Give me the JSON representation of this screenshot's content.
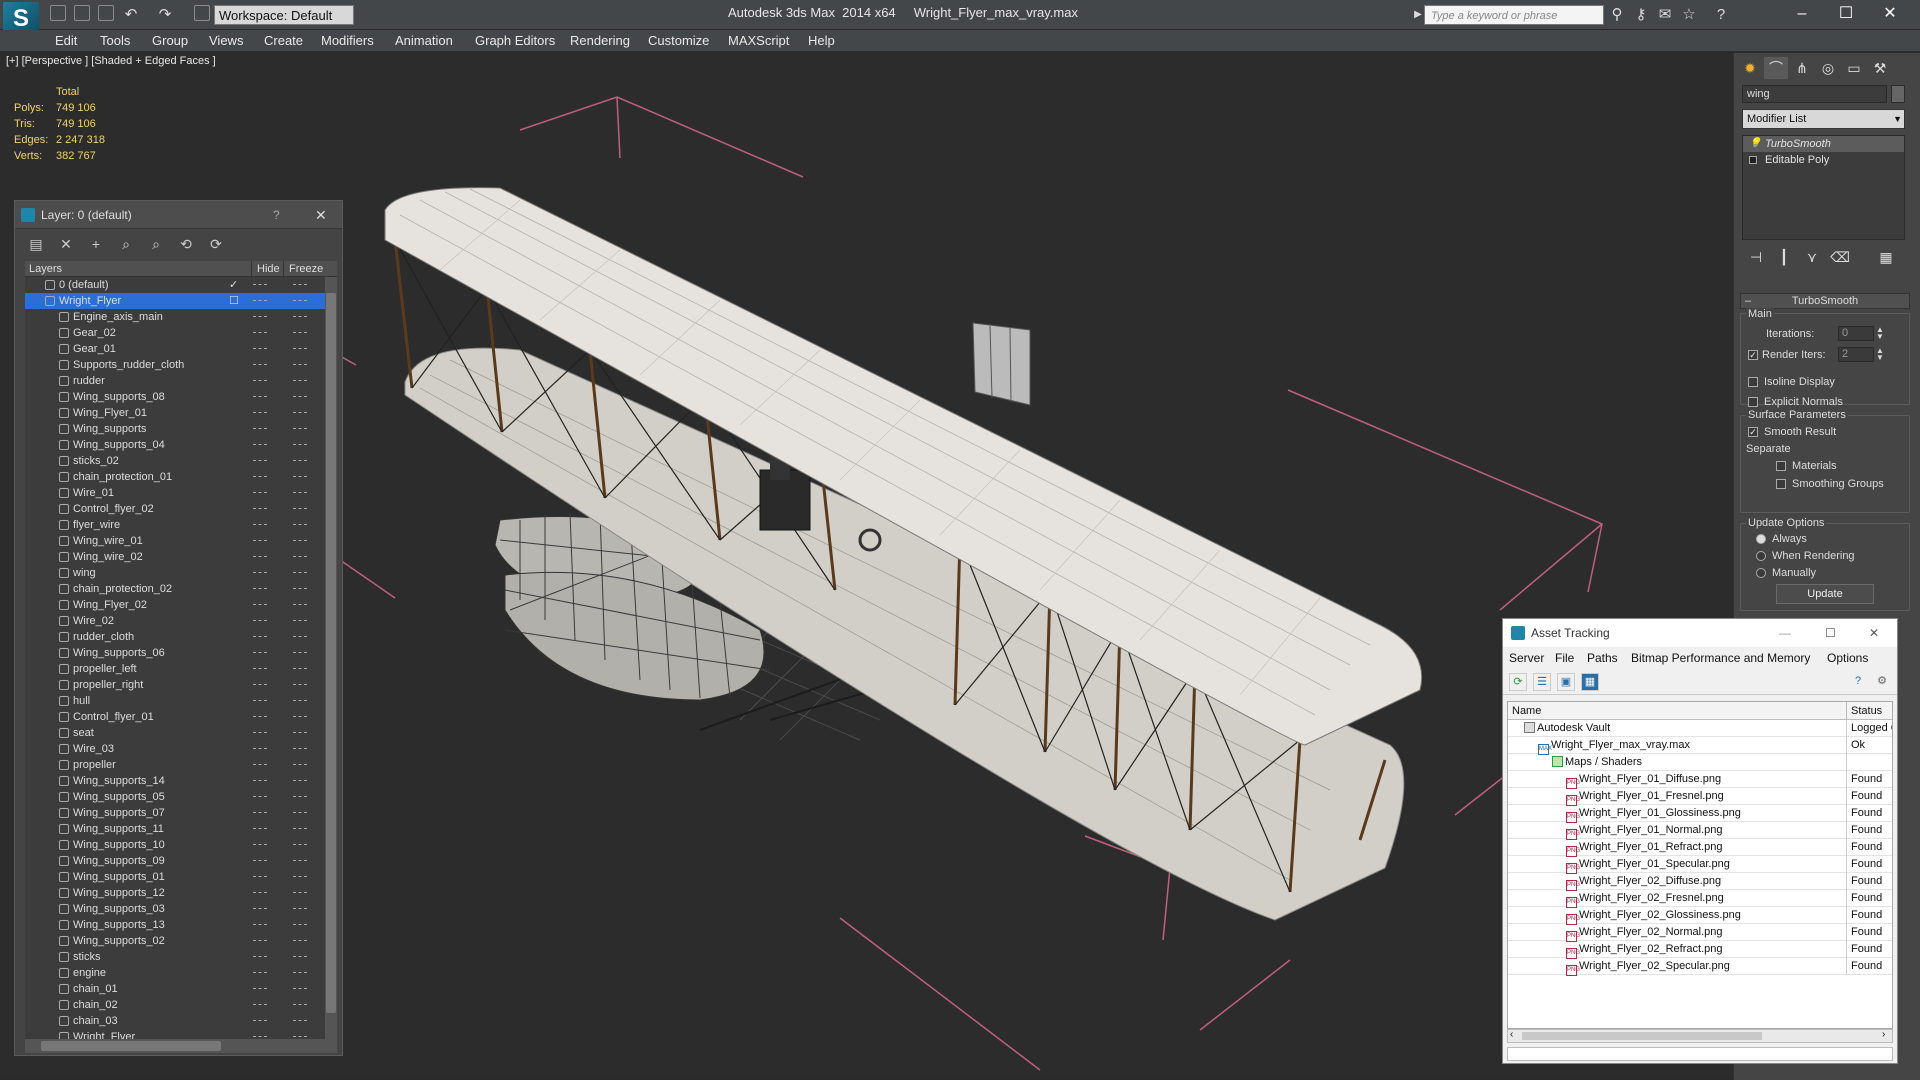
{
  "titlebar": {
    "workspace": "Workspace: Default",
    "app_name": "Autodesk 3ds Max  2014 x64",
    "file_name": "Wright_Flyer_max_vray.max",
    "search_placeholder": "Type a keyword or phrase"
  },
  "menu": [
    "Edit",
    "Tools",
    "Group",
    "Views",
    "Create",
    "Modifiers",
    "Animation",
    "Graph Editors",
    "Rendering",
    "Customize",
    "MAXScript",
    "Help"
  ],
  "viewport": {
    "label": "[+] [Perspective ] [Shaded + Edged Faces ]",
    "stats_header": "Total",
    "stats": [
      {
        "label": "Polys:",
        "value": "749 106"
      },
      {
        "label": "Tris:",
        "value": "749 106"
      },
      {
        "label": "Edges:",
        "value": "2 247 318"
      },
      {
        "label": "Verts:",
        "value": "382 767"
      }
    ]
  },
  "layer_panel": {
    "title": "Layer: 0 (default)",
    "help": "?",
    "col_layers": "Layers",
    "col_hide": "Hide",
    "col_freeze": "Freeze",
    "rows": [
      {
        "name": "0 (default)",
        "level": 1,
        "check": true
      },
      {
        "name": "Wright_Flyer",
        "level": 1,
        "selected": true
      },
      {
        "name": "Engine_axis_main",
        "level": 2
      },
      {
        "name": "Gear_02",
        "level": 2
      },
      {
        "name": "Gear_01",
        "level": 2
      },
      {
        "name": "Supports_rudder_cloth",
        "level": 2
      },
      {
        "name": "rudder",
        "level": 2
      },
      {
        "name": "Wing_supports_08",
        "level": 2
      },
      {
        "name": "Wing_Flyer_01",
        "level": 2
      },
      {
        "name": "Wing_supports",
        "level": 2
      },
      {
        "name": "Wing_supports_04",
        "level": 2
      },
      {
        "name": "sticks_02",
        "level": 2
      },
      {
        "name": "chain_protection_01",
        "level": 2
      },
      {
        "name": "Wire_01",
        "level": 2
      },
      {
        "name": "Control_flyer_02",
        "level": 2
      },
      {
        "name": "flyer_wire",
        "level": 2
      },
      {
        "name": "Wing_wire_01",
        "level": 2
      },
      {
        "name": "Wing_wire_02",
        "level": 2
      },
      {
        "name": "wing",
        "level": 2
      },
      {
        "name": "chain_protection_02",
        "level": 2
      },
      {
        "name": "Wing_Flyer_02",
        "level": 2
      },
      {
        "name": "Wire_02",
        "level": 2
      },
      {
        "name": "rudder_cloth",
        "level": 2
      },
      {
        "name": "Wing_supports_06",
        "level": 2
      },
      {
        "name": "propeller_left",
        "level": 2
      },
      {
        "name": "propeller_right",
        "level": 2
      },
      {
        "name": "hull",
        "level": 2
      },
      {
        "name": "Control_flyer_01",
        "level": 2
      },
      {
        "name": "seat",
        "level": 2
      },
      {
        "name": "Wire_03",
        "level": 2
      },
      {
        "name": "propeller",
        "level": 2
      },
      {
        "name": "Wing_supports_14",
        "level": 2
      },
      {
        "name": "Wing_supports_05",
        "level": 2
      },
      {
        "name": "Wing_supports_07",
        "level": 2
      },
      {
        "name": "Wing_supports_11",
        "level": 2
      },
      {
        "name": "Wing_supports_10",
        "level": 2
      },
      {
        "name": "Wing_supports_09",
        "level": 2
      },
      {
        "name": "Wing_supports_01",
        "level": 2
      },
      {
        "name": "Wing_supports_12",
        "level": 2
      },
      {
        "name": "Wing_supports_03",
        "level": 2
      },
      {
        "name": "Wing_supports_13",
        "level": 2
      },
      {
        "name": "Wing_supports_02",
        "level": 2
      },
      {
        "name": "sticks",
        "level": 2
      },
      {
        "name": "engine",
        "level": 2
      },
      {
        "name": "chain_01",
        "level": 2
      },
      {
        "name": "chain_02",
        "level": 2
      },
      {
        "name": "chain_03",
        "level": 2
      },
      {
        "name": "Wright_Flyer",
        "level": 2
      }
    ]
  },
  "command_panel": {
    "object_name": "wing",
    "modifier_list": "Modifier List",
    "stack": [
      "TurboSmooth",
      "Editable Poly"
    ],
    "rollout_title": "TurboSmooth",
    "main_label": "Main",
    "iterations_label": "Iterations:",
    "iterations_value": "0",
    "render_iters_label": "Render Iters:",
    "render_iters_value": "2",
    "isoline": "Isoline Display",
    "explicit_normals": "Explicit Normals",
    "surface_params": "Surface Parameters",
    "smooth_result": "Smooth Result",
    "separate": "Separate",
    "materials": "Materials",
    "smoothing_groups": "Smoothing Groups",
    "update_options": "Update Options",
    "always": "Always",
    "when_rendering": "When Rendering",
    "manually": "Manually",
    "update_button": "Update"
  },
  "asset_tracking": {
    "title": "Asset Tracking",
    "menu": [
      "Server",
      "File",
      "Paths",
      "Bitmap Performance and Memory",
      "Options"
    ],
    "col_name": "Name",
    "col_status": "Status",
    "rows": [
      {
        "name": "Autodesk Vault",
        "status": "Logged O",
        "indent": 16,
        "kind": "vault"
      },
      {
        "name": "Wright_Flyer_max_vray.max",
        "status": "Ok",
        "indent": 30,
        "kind": "max"
      },
      {
        "name": "Maps / Shaders",
        "status": "",
        "indent": 44,
        "kind": "folder"
      },
      {
        "name": "Wright_Flyer_01_Diffuse.png",
        "status": "Found",
        "indent": 58,
        "kind": "png"
      },
      {
        "name": "Wright_Flyer_01_Fresnel.png",
        "status": "Found",
        "indent": 58,
        "kind": "png"
      },
      {
        "name": "Wright_Flyer_01_Glossiness.png",
        "status": "Found",
        "indent": 58,
        "kind": "png"
      },
      {
        "name": "Wright_Flyer_01_Normal.png",
        "status": "Found",
        "indent": 58,
        "kind": "png"
      },
      {
        "name": "Wright_Flyer_01_Refract.png",
        "status": "Found",
        "indent": 58,
        "kind": "png"
      },
      {
        "name": "Wright_Flyer_01_Specular.png",
        "status": "Found",
        "indent": 58,
        "kind": "png"
      },
      {
        "name": "Wright_Flyer_02_Diffuse.png",
        "status": "Found",
        "indent": 58,
        "kind": "png"
      },
      {
        "name": "Wright_Flyer_02_Fresnel.png",
        "status": "Found",
        "indent": 58,
        "kind": "png"
      },
      {
        "name": "Wright_Flyer_02_Glossiness.png",
        "status": "Found",
        "indent": 58,
        "kind": "png"
      },
      {
        "name": "Wright_Flyer_02_Normal.png",
        "status": "Found",
        "indent": 58,
        "kind": "png"
      },
      {
        "name": "Wright_Flyer_02_Refract.png",
        "status": "Found",
        "indent": 58,
        "kind": "png"
      },
      {
        "name": "Wright_Flyer_02_Specular.png",
        "status": "Found",
        "indent": 58,
        "kind": "png"
      }
    ]
  },
  "colors": {
    "selection": "#2b6fd6",
    "stats_yellow": "#f1d26f",
    "bbox_pink": "#d86a8c"
  }
}
